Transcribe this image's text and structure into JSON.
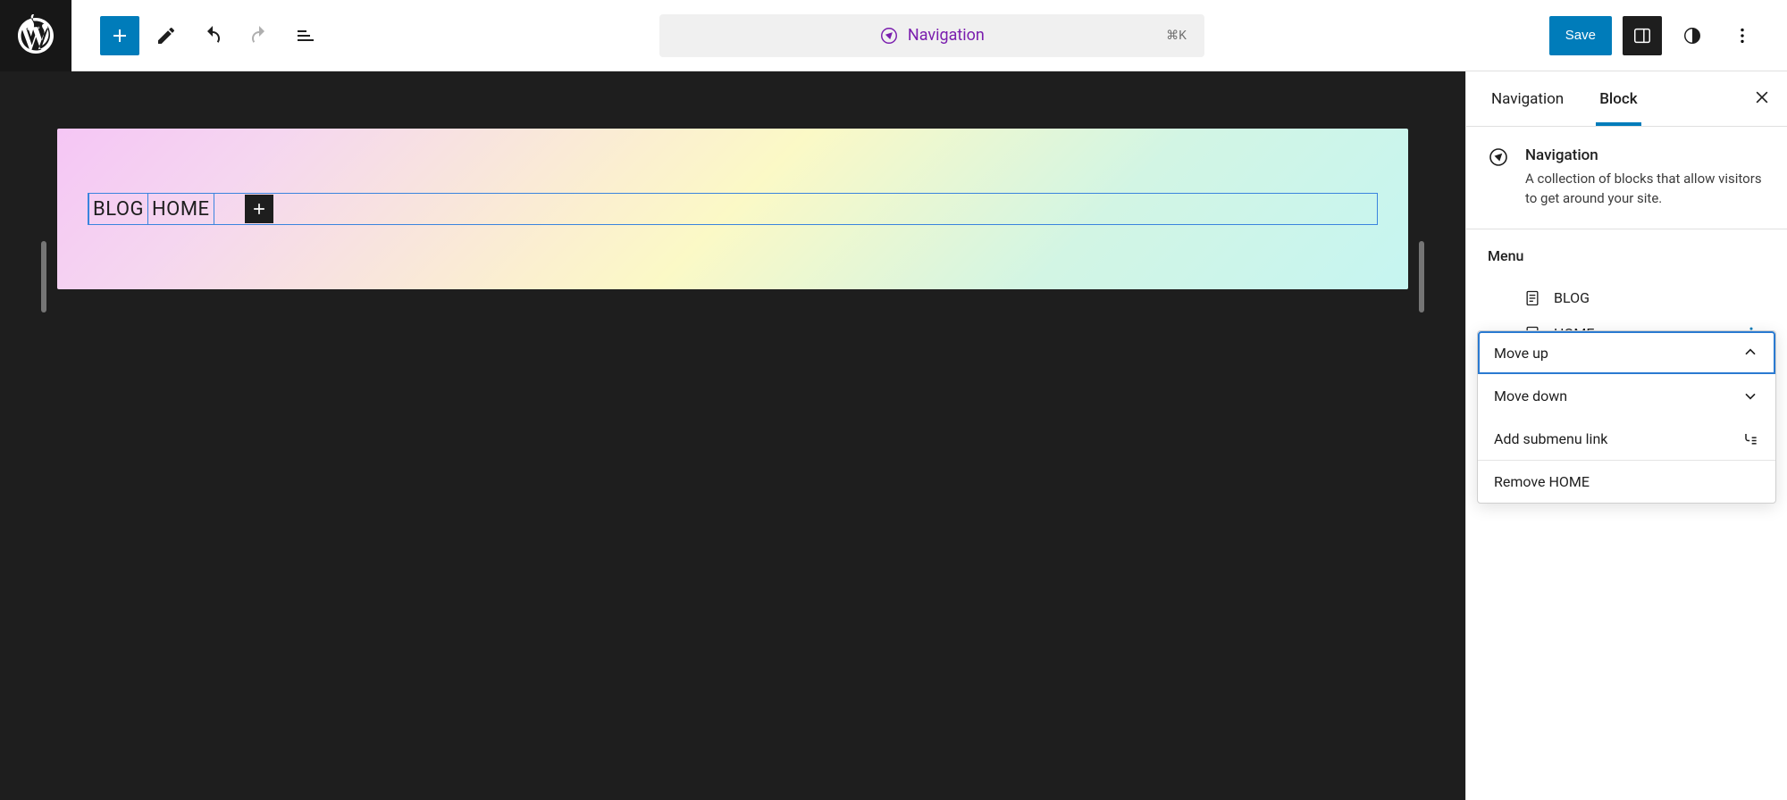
{
  "topbar": {
    "title": "Navigation",
    "shortcut": "⌘K",
    "save_label": "Save"
  },
  "canvas": {
    "nav_items": [
      "BLOG",
      "HOME"
    ]
  },
  "sidebar": {
    "tabs": {
      "primary": "Navigation",
      "secondary": "Block"
    },
    "block_card": {
      "title": "Navigation",
      "description": "A collection of blocks that allow visitors to get around your site."
    },
    "menu": {
      "title": "Menu",
      "items": [
        "BLOG",
        "HOME"
      ]
    },
    "dropdown": {
      "move_up": "Move up",
      "move_down": "Move down",
      "add_submenu": "Add submenu link",
      "remove": "Remove HOME"
    }
  }
}
